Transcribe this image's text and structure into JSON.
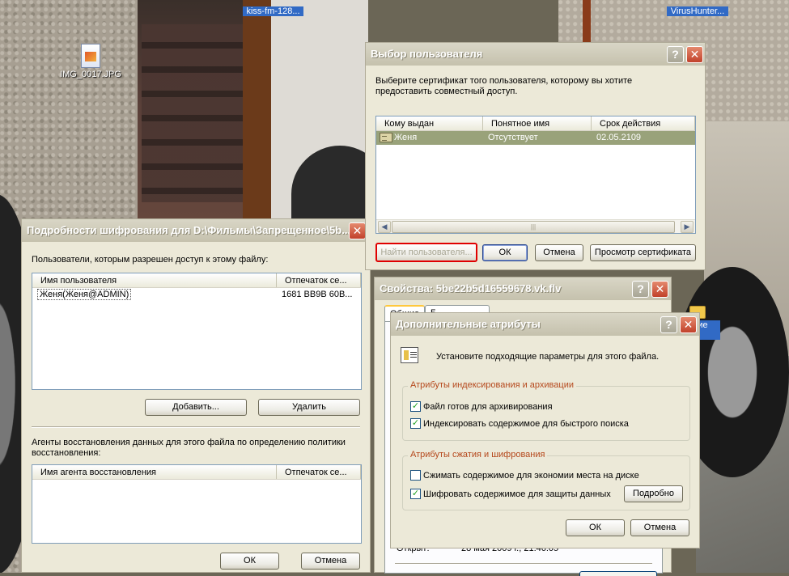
{
  "desktop": {
    "icons": [
      {
        "label": "IMG_0017.JPG"
      },
      {
        "label": "kiss-fm-128..."
      },
      {
        "label": "VirusHunter..."
      },
      {
        "label": "ские\nги"
      }
    ]
  },
  "encryption_details": {
    "title": "Подробности шифрования для D:\\Фильмы\\Запрещенное\\5b...",
    "users_caption": "Пользователи, которым разрешен доступ к этому файлу:",
    "users_columns": [
      "Имя пользователя",
      "Отпечаток се..."
    ],
    "users_rows": [
      {
        "name": "Женя(Женя@ADMIN)",
        "thumbprint": "1681 BB9B 60B..."
      }
    ],
    "add_label": "Добавить...",
    "remove_label": "Удалить",
    "agents_caption": "Агенты восстановления данных для этого файла по определению политики восстановления:",
    "agents_columns": [
      "Имя агента восстановления",
      "Отпечаток се..."
    ],
    "ok_label": "ОК",
    "cancel_label": "Отмена"
  },
  "select_user": {
    "title": "Выбор пользователя",
    "prompt": "Выберите сертификат того пользователя, которому вы хотите предоставить совместный доступ.",
    "columns": [
      "Кому выдан",
      "Понятное имя",
      "Срок действия"
    ],
    "rows": [
      {
        "issued_to": "Женя",
        "friendly_name": "Отсутствует",
        "expires": "02.05.2109"
      }
    ],
    "find_user_label": "Найти пользователя...",
    "ok_label": "ОК",
    "cancel_label": "Отмена",
    "view_cert_label": "Просмотр сертификата"
  },
  "properties": {
    "title": "Свойства: 5be22b5d16559678.vk.flv",
    "tabs": [
      "Общие",
      "Б..."
    ],
    "opened_label": "Открыт:",
    "opened_value": "28 мая 2009 г., 21:46:05"
  },
  "advanced_attributes": {
    "title": "Дополнительные атрибуты",
    "intro": "Установите подходящие параметры для этого файла.",
    "index_group_title": "Атрибуты индексирования и архивации",
    "archive_label": "Файл готов для архивирования",
    "archive_checked": true,
    "index_label": "Индексировать содержимое для быстрого поиска",
    "index_checked": true,
    "compress_group_title": "Атрибуты сжатия и шифрования",
    "compress_label": "Сжимать содержимое для экономии места на диске",
    "compress_checked": false,
    "encrypt_label": "Шифровать содержимое для защиты данных",
    "encrypt_checked": true,
    "details_label": "Подробно",
    "ok_label": "ОК",
    "cancel_label": "Отмена"
  },
  "common": {
    "help_glyph": "?",
    "close_glyph": "✕",
    "check_glyph": "✓"
  }
}
